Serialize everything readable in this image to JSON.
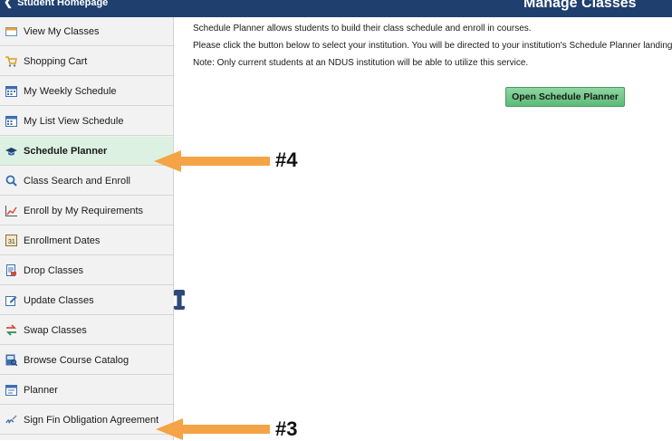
{
  "header": {
    "back_label": "Student Homepage",
    "title": "Manage Classes"
  },
  "sidebar": {
    "items": [
      {
        "label": "View My Classes",
        "icon": "classes-icon"
      },
      {
        "label": "Shopping Cart",
        "icon": "cart-icon"
      },
      {
        "label": "My Weekly Schedule",
        "icon": "calendar-icon"
      },
      {
        "label": "My List View Schedule",
        "icon": "calendar-list-icon"
      },
      {
        "label": "Schedule Planner",
        "icon": "graduation-cap-icon",
        "active": true
      },
      {
        "label": "Class Search and Enroll",
        "icon": "search-icon"
      },
      {
        "label": "Enroll by My Requirements",
        "icon": "chart-icon"
      },
      {
        "label": "Enrollment Dates",
        "icon": "date-icon"
      },
      {
        "label": "Drop Classes",
        "icon": "drop-icon"
      },
      {
        "label": "Update Classes",
        "icon": "edit-icon"
      },
      {
        "label": "Swap Classes",
        "icon": "swap-icon"
      },
      {
        "label": "Browse Course Catalog",
        "icon": "catalog-icon"
      },
      {
        "label": "Planner",
        "icon": "planner-icon"
      },
      {
        "label": "Sign Fin Obligation Agreement",
        "icon": "signature-icon"
      }
    ]
  },
  "main": {
    "line1": "Schedule Planner allows students to build their class schedule and enroll in courses.",
    "line2": "Please click the button below to select your institution. You will be directed to your institution's Schedule Planner landing pag",
    "line3": "Note: Only current students at an NDUS institution will be able to utilize this service.",
    "button_label": "Open Schedule Planner"
  },
  "annotations": {
    "a4": "#4",
    "a3": "#3"
  },
  "colors": {
    "header": "#1f3f6e",
    "active_item": "#dcf1e1",
    "button": "#5cbb76",
    "arrow": "#f4a446"
  }
}
